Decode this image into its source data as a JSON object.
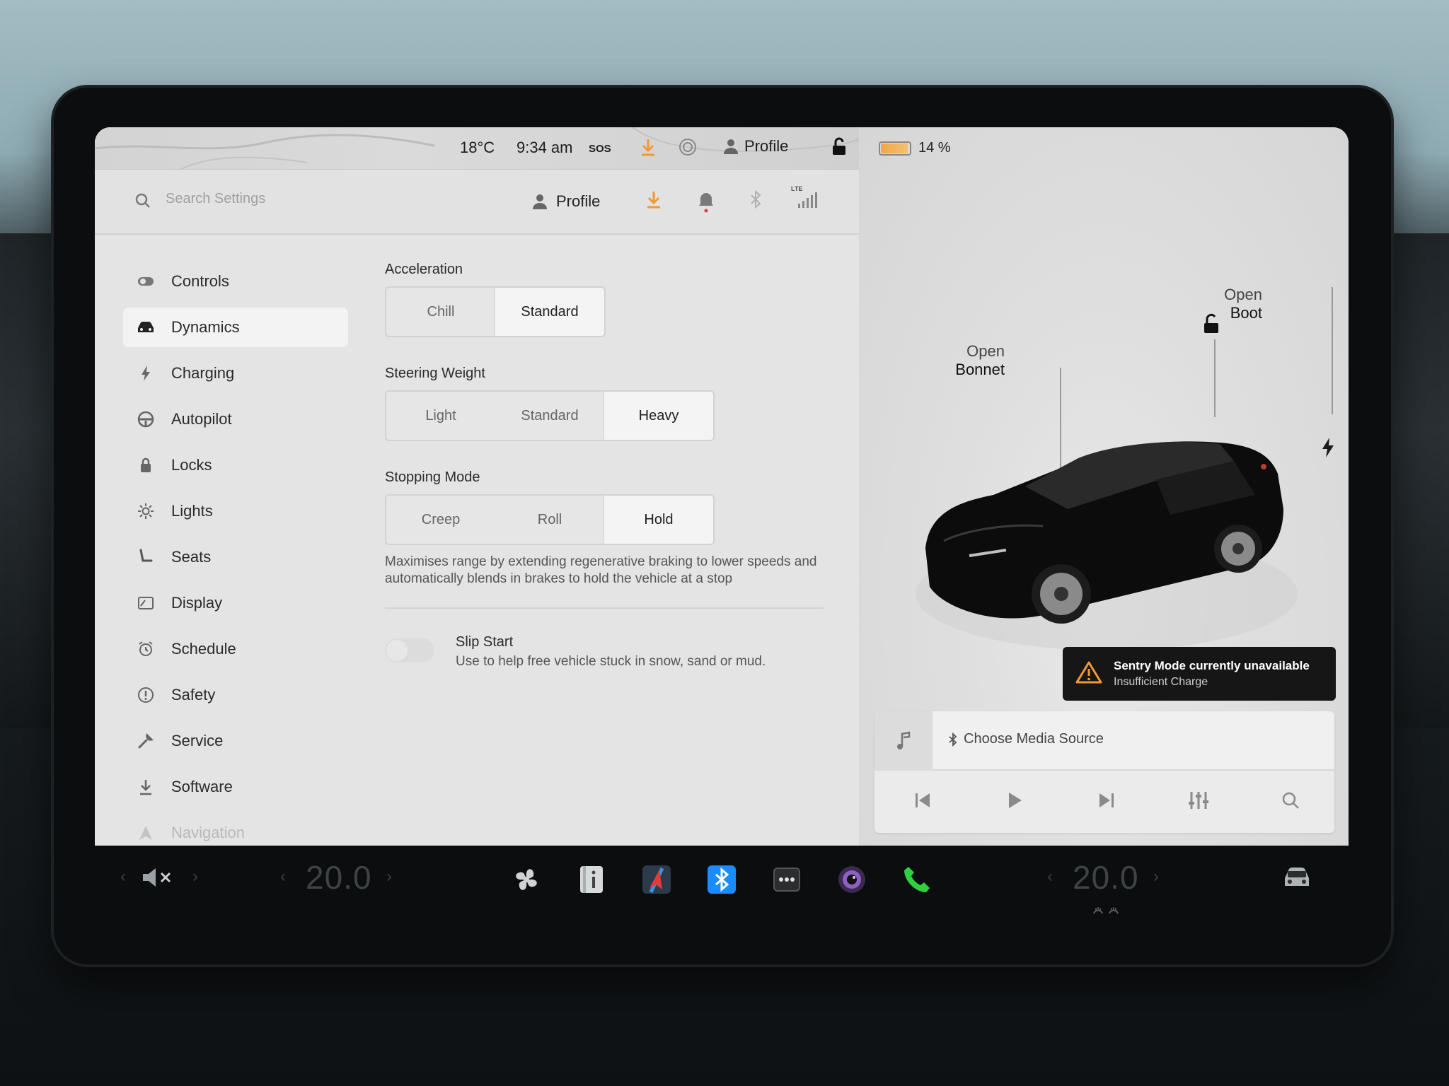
{
  "status_bar": {
    "temperature": "18°C",
    "time": "9:34 am",
    "sos": "SOS",
    "profile": "Profile"
  },
  "header": {
    "search_placeholder": "Search Settings",
    "profile": "Profile",
    "network": "LTE"
  },
  "sidebar": {
    "items": [
      {
        "label": "Controls",
        "icon": "toggle-icon"
      },
      {
        "label": "Dynamics",
        "icon": "car-icon",
        "active": true
      },
      {
        "label": "Charging",
        "icon": "bolt-icon"
      },
      {
        "label": "Autopilot",
        "icon": "steering-wheel-icon"
      },
      {
        "label": "Locks",
        "icon": "lock-icon"
      },
      {
        "label": "Lights",
        "icon": "sun-icon"
      },
      {
        "label": "Seats",
        "icon": "seat-icon"
      },
      {
        "label": "Display",
        "icon": "display-icon"
      },
      {
        "label": "Schedule",
        "icon": "alarm-clock-icon"
      },
      {
        "label": "Safety",
        "icon": "exclamation-circle-icon"
      },
      {
        "label": "Service",
        "icon": "wrench-icon"
      },
      {
        "label": "Software",
        "icon": "download-icon"
      },
      {
        "label": "Navigation",
        "icon": "navigation-icon"
      }
    ]
  },
  "dynamics": {
    "acceleration": {
      "title": "Acceleration",
      "options": [
        "Chill",
        "Standard"
      ],
      "selected": "Standard"
    },
    "steering_weight": {
      "title": "Steering Weight",
      "options": [
        "Light",
        "Standard",
        "Heavy"
      ],
      "selected": "Heavy"
    },
    "stopping_mode": {
      "title": "Stopping Mode",
      "options": [
        "Creep",
        "Roll",
        "Hold"
      ],
      "selected": "Hold",
      "description": "Maximises range by extending regenerative braking to lower speeds and automatically blends in brakes to hold the vehicle at a stop"
    },
    "slip_start": {
      "title": "Slip Start",
      "description": "Use to help free vehicle stuck in snow, sand or mud.",
      "enabled": false
    }
  },
  "vehicle": {
    "battery_percent": "14 %",
    "open_bonnet": {
      "line1": "Open",
      "line2": "Bonnet"
    },
    "open_boot": {
      "line1": "Open",
      "line2": "Boot"
    },
    "sentry": {
      "title": "Sentry Mode currently unavailable",
      "subtitle": "Insufficient Charge"
    }
  },
  "media": {
    "source_label": "Choose Media Source"
  },
  "bottom_bar": {
    "driver_temp": "20.0",
    "passenger_temp": "20.0"
  },
  "colors": {
    "accent_orange": "#f29a2e",
    "bluetooth_blue": "#1a8cff",
    "phone_green": "#2fd03f"
  }
}
